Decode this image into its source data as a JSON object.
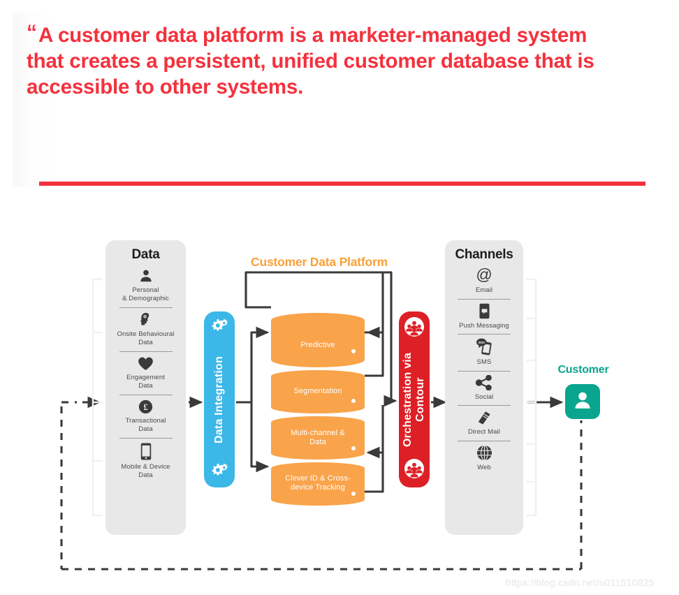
{
  "quote": {
    "mark": "“",
    "text": "A customer data platform is a marketer-managed system that creates a persistent, unified customer database that is accessible to other systems.",
    "accent_color": "#f4313d"
  },
  "diagram": {
    "title_cdp": "Customer Data Platform",
    "data_panel": {
      "title": "Data",
      "items": [
        {
          "icon": "person-icon",
          "label": "Personal\n& Demographic"
        },
        {
          "icon": "head-brain-icon",
          "label": "Onsite Behavioural\nData"
        },
        {
          "icon": "heart-icon",
          "label": "Engagement\nData"
        },
        {
          "icon": "pound-coin-icon",
          "label": "Transactional\nData"
        },
        {
          "icon": "mobile-phone-icon",
          "label": "Mobile & Device\nData"
        }
      ]
    },
    "integration": {
      "label": "Data Integration",
      "color": "#3bb7e8",
      "icon": "gears-icon"
    },
    "platform": {
      "color": "#f9a34a",
      "layers": [
        {
          "label": "Predictive"
        },
        {
          "label": "Segmentation"
        },
        {
          "label": "Multi-channel &\nData"
        },
        {
          "label": "Clever ID & Cross-device Tracking"
        }
      ]
    },
    "orchestration": {
      "label": "Orchestration via Contour",
      "color": "#dd2026",
      "icon": "people-group-icon"
    },
    "channels_panel": {
      "title": "Channels",
      "items": [
        {
          "icon": "at-sign-icon",
          "label": "Email"
        },
        {
          "icon": "push-notification-icon",
          "label": "Push Messaging"
        },
        {
          "icon": "sms-icon",
          "label": "SMS"
        },
        {
          "icon": "share-social-icon",
          "label": "Social"
        },
        {
          "icon": "direct-mail-icon",
          "label": "Direct Mail"
        },
        {
          "icon": "globe-icon",
          "label": "Web"
        }
      ]
    },
    "customer": {
      "label": "Customer",
      "color": "#0aa58e",
      "icon": "user-avatar-icon"
    }
  },
  "watermark": {
    "text": "https://blog.csdn.net/u011510825"
  }
}
